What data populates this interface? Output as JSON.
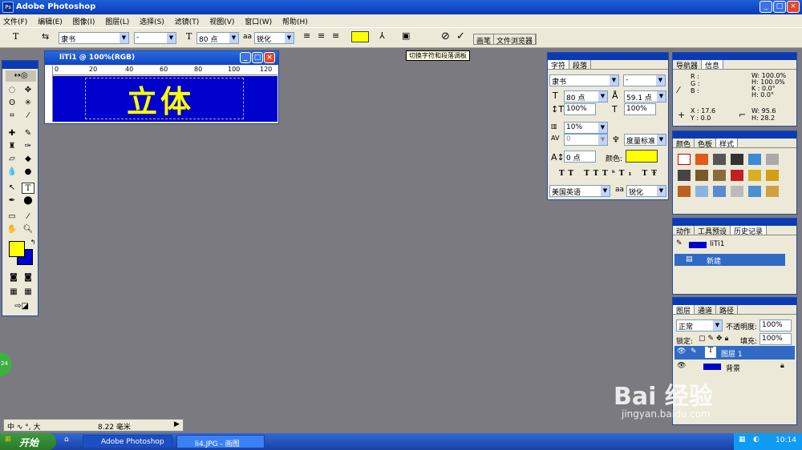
{
  "app": {
    "title": "Adobe Photoshop"
  },
  "menu": [
    "文件(F)",
    "编辑(E)",
    "图像(I)",
    "图层(L)",
    "选择(S)",
    "滤镜(T)",
    "视图(V)",
    "窗口(W)",
    "帮助(H)"
  ],
  "options": {
    "font_family": "隶书",
    "font_style": "-",
    "font_size": "80 点",
    "antialias_icon": "aa",
    "antialias": "锐化",
    "text_color": "#ffff00",
    "cancel_icon": "⊘",
    "commit_icon": "✓",
    "tabwell": [
      "画笔",
      "文件浏览器"
    ]
  },
  "tooltip": "切换字符和段落调板",
  "document": {
    "title": "liTi1 @ 100%(RGB)",
    "ruler": [
      "0",
      "20",
      "40",
      "60",
      "80",
      "100",
      "120"
    ],
    "canvas_text": "立体",
    "canvas_color": "#0000cc",
    "text_color": "#ffff00"
  },
  "character_panel": {
    "tabs": [
      "字符",
      "段落"
    ],
    "font_family": "隶书",
    "font_style": "-",
    "size": "80 点",
    "leading": "59.1 点",
    "vscale": "100%",
    "hscale": "100%",
    "tracking": "10%",
    "kerning": "0",
    "kerning_method": "度量标准",
    "baseline": "0 点",
    "color_label": "颜色:",
    "color": "#ffff00",
    "language": "美国英语",
    "antialias_icon": "aa",
    "antialias": "锐化"
  },
  "navigator_panel": {
    "tabs": [
      "导航器",
      "信息"
    ],
    "rgb": [
      "R :",
      "G :",
      "B :"
    ],
    "w": "W: 100.0%",
    "h_pct": "H: 100.0%",
    "k": "K : 0.0°",
    "hdeg": "H: 0.0°",
    "x": "X : 17.6",
    "y": "Y : 0.0",
    "w2": "W: 95.6",
    "h2": "H: 28.2"
  },
  "swatches_panel": {
    "tabs": [
      "颜色",
      "色板",
      "样式"
    ]
  },
  "history_panel": {
    "tabs": [
      "动作",
      "工具预设",
      "历史记录"
    ],
    "snapshot": "liTi1",
    "state": "新建"
  },
  "layers_panel": {
    "tabs": [
      "图层",
      "通道",
      "路径"
    ],
    "blend": "正常",
    "opacity_label": "不透明度:",
    "opacity": "100%",
    "lock_label": "锁定:",
    "fill_label": "填充:",
    "fill": "100%",
    "layers": [
      {
        "name": "图层 1",
        "type": "T"
      },
      {
        "name": "背景",
        "type": "image"
      }
    ]
  },
  "status": {
    "text": "8.22 毫米",
    "ime": "中 ∿ °, 大"
  },
  "taskbar": {
    "start": "开始",
    "tasks": [
      "Adobe Photoshop",
      "li4.JPG - 画图"
    ],
    "clock": "10:14"
  },
  "badge": "24",
  "watermark": {
    "logo": "Bai 经验",
    "url": "jingyan.baidu.com"
  }
}
